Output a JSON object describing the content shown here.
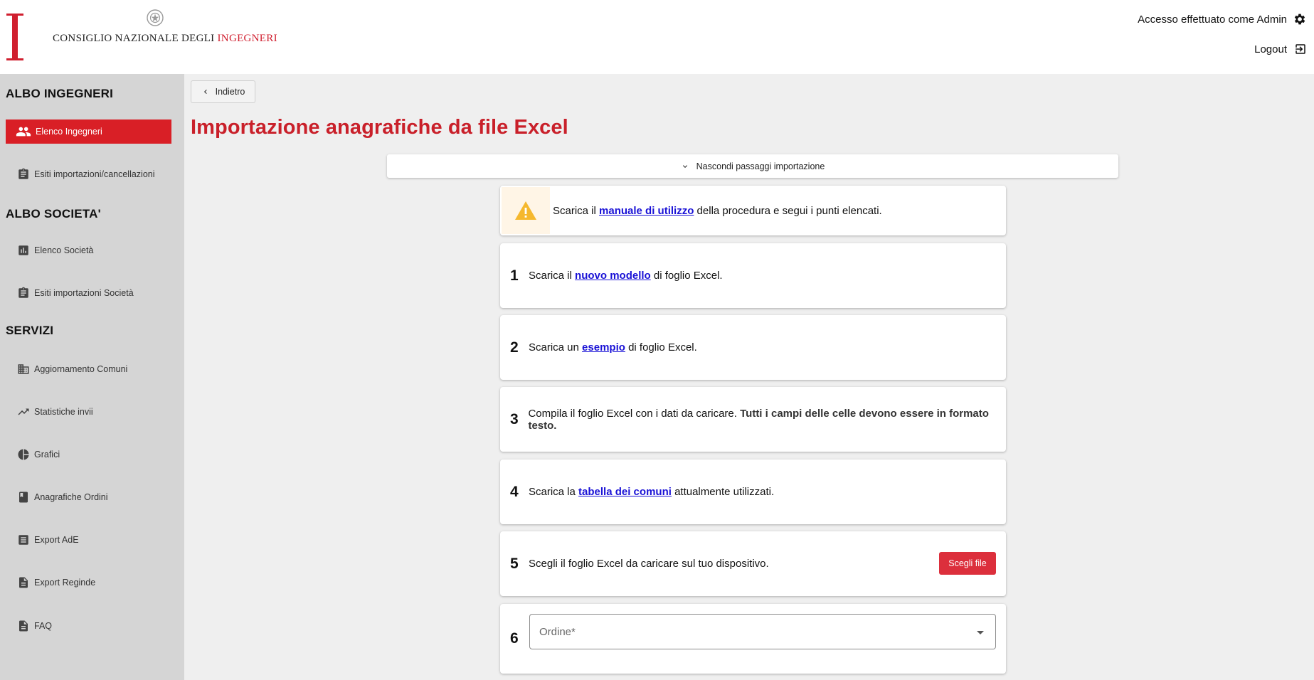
{
  "header": {
    "org_name_main": "CONSIGLIO NAZIONALE DEGLI ",
    "org_name_accent": "INGEGNERI",
    "user_text": "Accesso effettuato come Admin",
    "logout_label": "Logout",
    "icons": {
      "settings": "gear-icon",
      "logout": "logout-icon",
      "emblem": "emblem-icon"
    }
  },
  "sidebar": {
    "sections": [
      {
        "title": "ALBO INGEGNERI"
      },
      {
        "title": "ALBO SOCIETA'"
      },
      {
        "title": "SERVIZI"
      }
    ],
    "items": [
      {
        "label": "Elenco Ingegneri",
        "icon": "people-icon",
        "active": true
      },
      {
        "label": "Esiti importazioni/cancellazioni",
        "icon": "clipboard-icon"
      },
      {
        "label": "Elenco Società",
        "icon": "bar-chart-icon"
      },
      {
        "label": "Esiti importazioni Società",
        "icon": "clipboard-icon"
      },
      {
        "label": "Aggiornamento Comuni",
        "icon": "buildings-icon"
      },
      {
        "label": "Statistiche invii",
        "icon": "trending-up-icon"
      },
      {
        "label": "Grafici",
        "icon": "pie-chart-icon"
      },
      {
        "label": "Anagrafiche Ordini",
        "icon": "book-icon"
      },
      {
        "label": "Export AdE",
        "icon": "list-icon"
      },
      {
        "label": "Export Reginde",
        "icon": "document-icon"
      },
      {
        "label": "FAQ",
        "icon": "document-icon"
      }
    ]
  },
  "main": {
    "back_label": "Indietro",
    "title": "Importazione anagrafiche da file Excel",
    "toggle_label": "Nascondi passaggi importazione",
    "warning": {
      "pre": "Scarica il ",
      "link": "manuale di utilizzo",
      "post": " della procedura e segui i punti elencati."
    },
    "steps": [
      {
        "num": "1",
        "pre": "Scarica il ",
        "link": "nuovo modello",
        "post": " di foglio Excel."
      },
      {
        "num": "2",
        "pre": "Scarica un ",
        "link": "esempio",
        "post": " di foglio Excel."
      },
      {
        "num": "3",
        "pre": "Compila il foglio Excel con i dati da caricare. ",
        "strong": "Tutti i campi delle celle devono essere in formato testo."
      },
      {
        "num": "4",
        "pre": "Scarica la ",
        "link": "tabella dei comuni",
        "post": " attualmente utilizzati."
      },
      {
        "num": "5",
        "pre": "Scegli il foglio Excel da caricare sul tuo dispositivo.",
        "button": "Scegli file"
      },
      {
        "num": "6",
        "select_placeholder": "Ordine*"
      }
    ]
  },
  "colors": {
    "accent": "#d91f26",
    "link": "#1a12d6",
    "warning": "#f5b82e"
  }
}
